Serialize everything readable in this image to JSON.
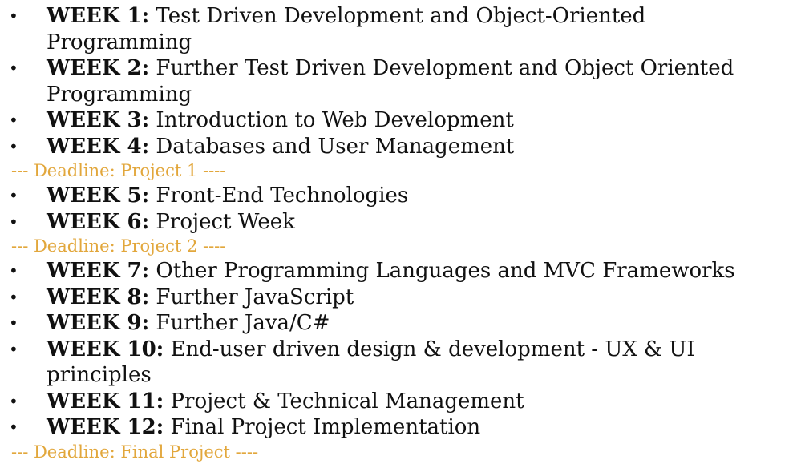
{
  "items": [
    {
      "kind": "week",
      "label": "WEEK 1:",
      "text": " Test Driven Development and Object-Oriented Programming"
    },
    {
      "kind": "week",
      "label": "WEEK 2:",
      "text": " Further Test Driven Development and Object Oriented Programming"
    },
    {
      "kind": "week",
      "label": "WEEK 3:",
      "text": " Introduction to Web Development"
    },
    {
      "kind": "week",
      "label": "WEEK 4:",
      "text": " Databases and User Management"
    },
    {
      "kind": "deadline",
      "text": "--- Deadline: Project 1 ----"
    },
    {
      "kind": "week",
      "label": "WEEK 5:",
      "text": " Front-End Technologies"
    },
    {
      "kind": "week",
      "label": "WEEK 6:",
      "text": " Project Week"
    },
    {
      "kind": "deadline",
      "text": "--- Deadline: Project 2 ----"
    },
    {
      "kind": "week",
      "label": "WEEK 7:",
      "text": " Other Programming Languages and MVC Frameworks"
    },
    {
      "kind": "week",
      "label": "WEEK 8:",
      "text": " Further JavaScript"
    },
    {
      "kind": "week",
      "label": "WEEK 9:",
      "text": " Further Java/C#"
    },
    {
      "kind": "week",
      "label": "WEEK 10:",
      "text": " End-user driven design & development - UX & UI principles"
    },
    {
      "kind": "week",
      "label": "WEEK 11:",
      "text": " Project & Technical Management"
    },
    {
      "kind": "week",
      "label": "WEEK 12:",
      "text": " Final Project Implementation"
    },
    {
      "kind": "deadline",
      "text": "--- Deadline: Final Project ----"
    }
  ],
  "bullet": "•",
  "colors": {
    "deadline": "#e2a73c",
    "text": "#111111"
  }
}
